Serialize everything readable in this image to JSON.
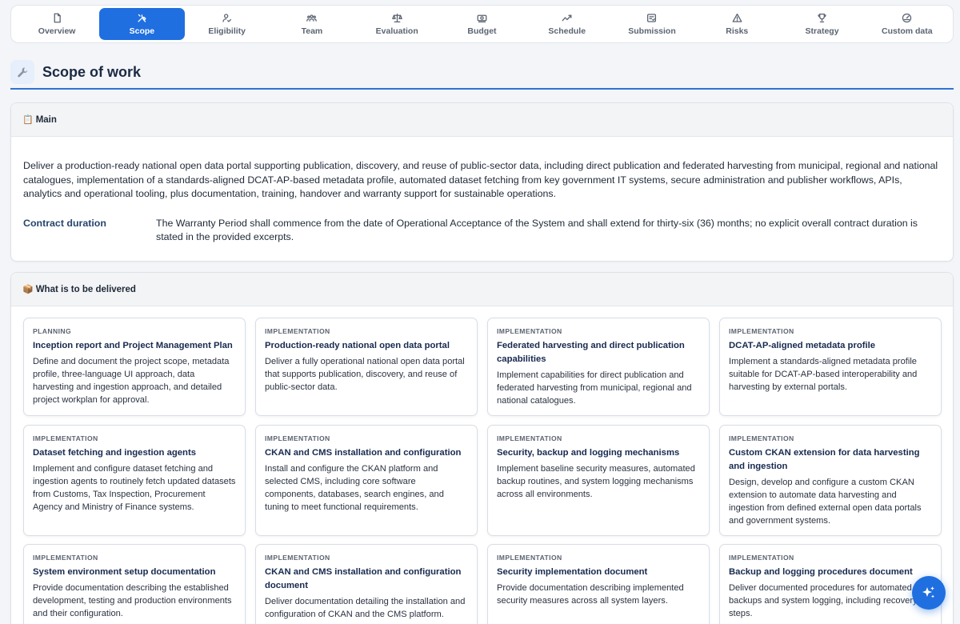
{
  "tabs": [
    {
      "label": "Overview",
      "icon": "document-icon"
    },
    {
      "label": "Scope",
      "icon": "tools-icon",
      "active": true
    },
    {
      "label": "Eligibility",
      "icon": "user-check-icon"
    },
    {
      "label": "Team",
      "icon": "team-icon"
    },
    {
      "label": "Evaluation",
      "icon": "scale-icon"
    },
    {
      "label": "Budget",
      "icon": "money-icon"
    },
    {
      "label": "Schedule",
      "icon": "trend-icon"
    },
    {
      "label": "Submission",
      "icon": "form-icon"
    },
    {
      "label": "Risks",
      "icon": "warning-icon"
    },
    {
      "label": "Strategy",
      "icon": "trophy-icon"
    },
    {
      "label": "Custom data",
      "icon": "gauge-icon"
    }
  ],
  "section": {
    "title": "Scope of work",
    "icon": "wrench-icon"
  },
  "main": {
    "header": "Main",
    "header_icon": "📋",
    "description": "Deliver a production-ready national open data portal supporting publication, discovery, and reuse of public-sector data, including direct publication and federated harvesting from municipal, regional and national catalogues, implementation of a standards-aligned DCAT-AP-based metadata profile, automated dataset fetching from key government IT systems, secure administration and publisher workflows, APIs, analytics and operational tooling, plus documentation, training, handover and warranty support for sustainable operations.",
    "contract_duration_label": "Contract duration",
    "contract_duration_value": "The Warranty Period shall commence from the date of Operational Acceptance of the System and shall extend for thirty-six (36) months; no explicit overall contract duration is stated in the provided excerpts."
  },
  "deliverables": {
    "header": "What is to be delivered",
    "header_icon": "📦",
    "items": [
      {
        "phase": "Planning",
        "title": "Inception report and Project Management Plan",
        "desc": "Define and document the project scope, metadata profile, three-language UI approach, data harvesting and ingestion approach, and detailed project workplan for approval."
      },
      {
        "phase": "Implementation",
        "title": "Production-ready national open data portal",
        "desc": "Deliver a fully operational national open data portal that supports publication, discovery, and reuse of public-sector data."
      },
      {
        "phase": "Implementation",
        "title": "Federated harvesting and direct publication capabilities",
        "desc": "Implement capabilities for direct publication and federated harvesting from municipal, regional and national catalogues."
      },
      {
        "phase": "Implementation",
        "title": "DCAT-AP-aligned metadata profile",
        "desc": "Implement a standards-aligned metadata profile suitable for DCAT-AP-based interoperability and harvesting by external portals."
      },
      {
        "phase": "Implementation",
        "title": "Dataset fetching and ingestion agents",
        "desc": "Implement and configure dataset fetching and ingestion agents to routinely fetch updated datasets from Customs, Tax Inspection, Procurement Agency and Ministry of Finance systems."
      },
      {
        "phase": "Implementation",
        "title": "CKAN and CMS installation and configuration",
        "desc": "Install and configure the CKAN platform and selected CMS, including core software components, databases, search engines, and tuning to meet functional requirements."
      },
      {
        "phase": "Implementation",
        "title": "Security, backup and logging mechanisms",
        "desc": "Implement baseline security measures, automated backup routines, and system logging mechanisms across all environments."
      },
      {
        "phase": "Implementation",
        "title": "Custom CKAN extension for data harvesting and ingestion",
        "desc": "Design, develop and configure a custom CKAN extension to automate data harvesting and ingestion from defined external open data portals and government systems."
      },
      {
        "phase": "Implementation",
        "title": "System environment setup documentation",
        "desc": "Provide documentation describing the established development, testing and production environments and their configuration."
      },
      {
        "phase": "Implementation",
        "title": "CKAN and CMS installation and configuration document",
        "desc": "Deliver documentation detailing the installation and configuration of CKAN and the CMS platform."
      },
      {
        "phase": "Implementation",
        "title": "Security implementation document",
        "desc": "Provide documentation describing implemented security measures across all system layers."
      },
      {
        "phase": "Implementation",
        "title": "Backup and logging procedures document",
        "desc": "Deliver documented procedures for automated data backups and system logging, including recovery steps."
      }
    ]
  },
  "fab": {
    "icon": "sparkles-icon"
  },
  "colors": {
    "accent": "#1f6fe0",
    "heading": "#1b2a44",
    "label": "#27456e"
  }
}
